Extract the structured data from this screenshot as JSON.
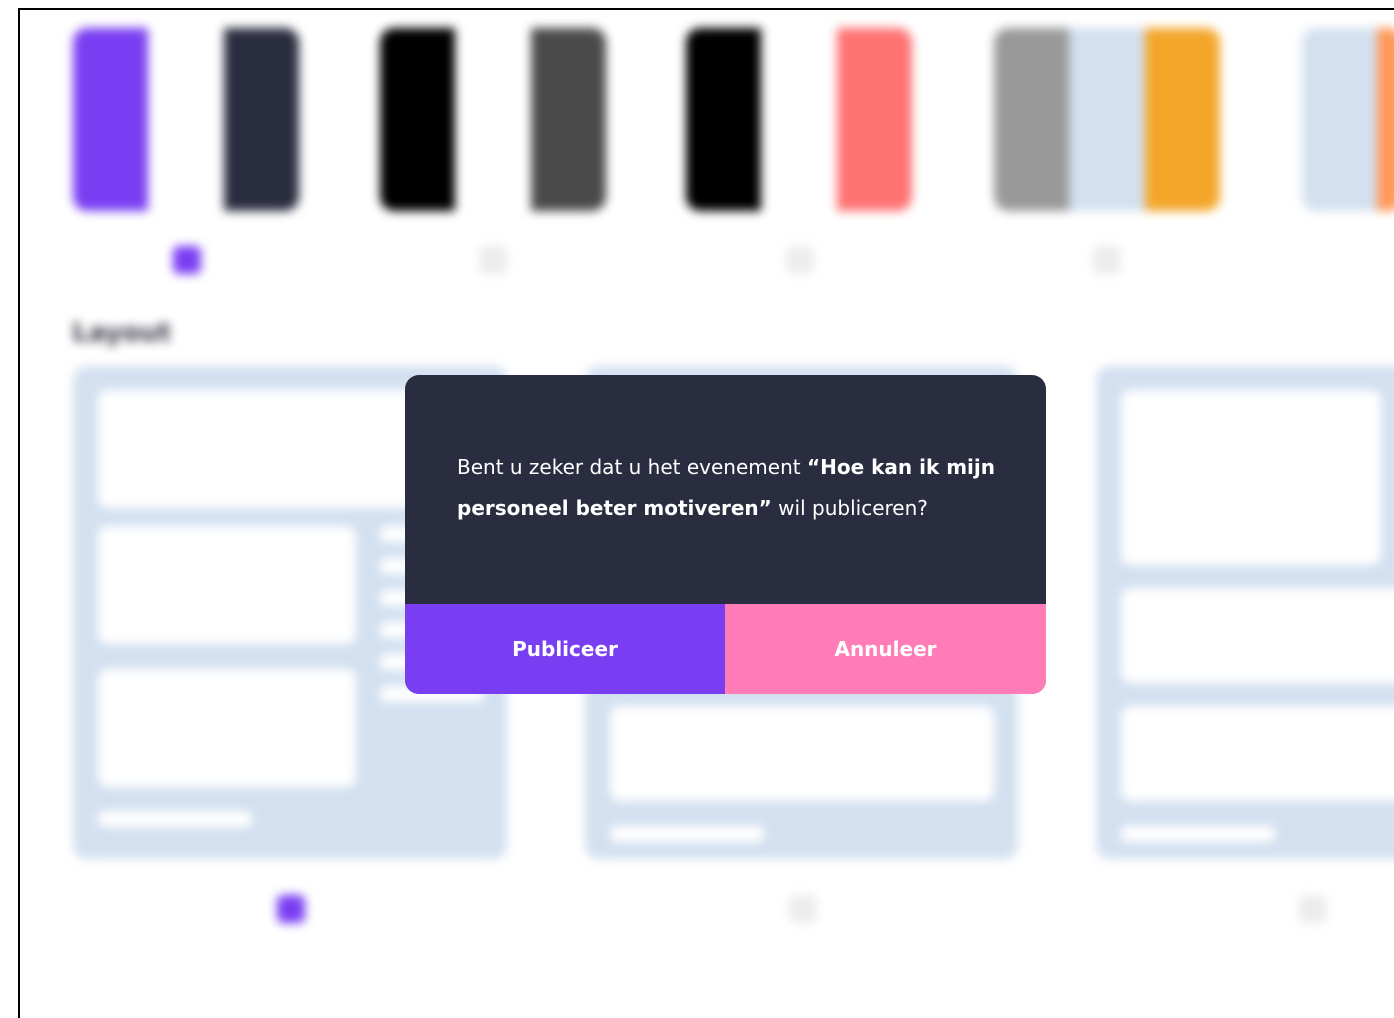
{
  "themes": [
    {
      "name": "theme-1",
      "colors": [
        "#7a3ef2",
        "#ffffff",
        "#2a2d40"
      ],
      "selected": true
    },
    {
      "name": "theme-2",
      "colors": [
        "#000000",
        "#ffffff",
        "#4a4a4a"
      ],
      "selected": false
    },
    {
      "name": "theme-3",
      "colors": [
        "#000000",
        "#ffffff",
        "#ff7272"
      ],
      "selected": false
    },
    {
      "name": "theme-4",
      "colors": [
        "#999999",
        "#d3e0f0",
        "#f4a62a"
      ],
      "selected": false
    },
    {
      "name": "theme-5",
      "colors": [
        "#d3e0f0",
        "#ff9a5a"
      ],
      "selected": false
    }
  ],
  "layout_section": {
    "title": "Layout",
    "selected_index": 0
  },
  "dialog": {
    "message_before": "Bent u zeker dat u het evenement ",
    "event_title": "“Hoe kan ik mijn personeel beter motiveren”",
    "message_after": " wil publiceren?",
    "confirm_label": "Publiceer",
    "cancel_label": "Annuleer"
  },
  "colors": {
    "accent_purple": "#7a3ef2",
    "accent_pink": "#ff7cb6",
    "dialog_background": "#2a2d40",
    "layout_card": "#d3e0f0"
  }
}
